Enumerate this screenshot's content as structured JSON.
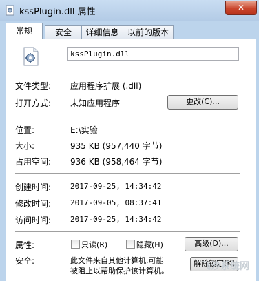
{
  "window": {
    "title": "kssPlugin.dll 属性",
    "close_label": "✕"
  },
  "tabs": [
    {
      "label": "常规",
      "active": true
    },
    {
      "label": "安全",
      "active": false
    },
    {
      "label": "详细信息",
      "active": false
    },
    {
      "label": "以前的版本",
      "active": false
    }
  ],
  "file": {
    "name": "kssPlugin.dll",
    "icon": "dll-file-icon"
  },
  "props": {
    "type_label": "文件类型:",
    "type_value": "应用程序扩展 (.dll)",
    "open_label": "打开方式:",
    "open_value": "未知应用程序",
    "change_button": "更改(C)...",
    "location_label": "位置:",
    "location_value": "E:\\实验",
    "size_label": "大小:",
    "size_value": "935 KB (957,440 字节)",
    "disk_label": "占用空间:",
    "disk_value": "936 KB (958,464 字节)",
    "created_label": "创建时间:",
    "created_value": "2017-09-25, 14:34:42",
    "modified_label": "修改时间:",
    "modified_value": "2017-09-05, 08:37:41",
    "accessed_label": "访问时间:",
    "accessed_value": "2017-09-25, 14:34:42",
    "attr_label": "属性:",
    "readonly_label": "只读(R)",
    "hidden_label": "隐藏(H)",
    "advanced_button": "高级(D)...",
    "security_label": "安全:",
    "security_text_1": "此文件来自其他计算机,可能",
    "security_text_2": "被阻止以帮助保护该计算机。",
    "unblock_button": "解除锁定(K)"
  },
  "watermark": "飞沙系统网"
}
